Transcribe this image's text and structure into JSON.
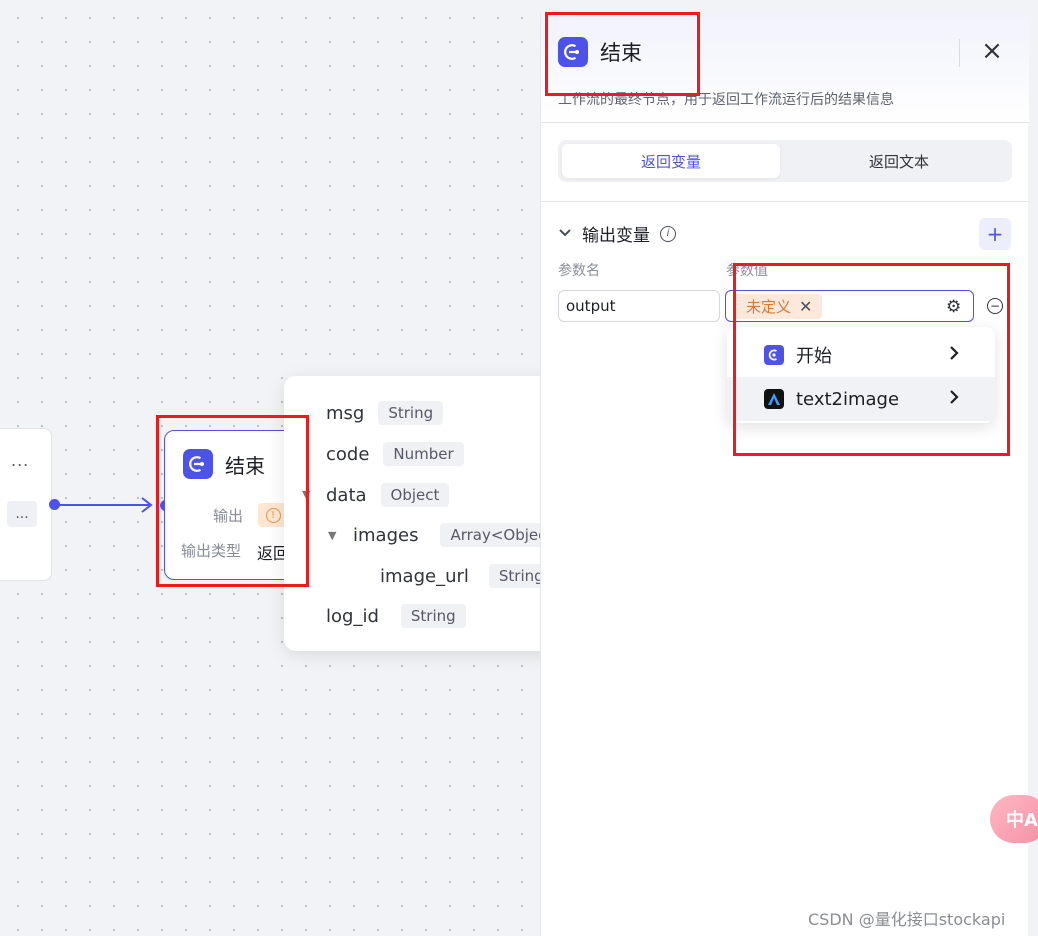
{
  "canvas": {
    "prev_node": {
      "more_1": "...",
      "more_2": "..."
    },
    "end_node": {
      "title": "结束",
      "output_label": "输出",
      "output_type_label": "输出类型",
      "output_type_value": "返回"
    }
  },
  "popover": {
    "items": [
      {
        "name": "msg",
        "type": "String"
      },
      {
        "name": "code",
        "type": "Number"
      },
      {
        "name": "data",
        "type": "Object"
      },
      {
        "name": "images",
        "type": "Array<Object>"
      },
      {
        "name": "image_url",
        "type": "String"
      },
      {
        "name": "log_id",
        "type": "String"
      }
    ]
  },
  "panel": {
    "title": "结束",
    "close": "×",
    "description": "工作流的最终节点，用于返回工作流运行后的结果信息",
    "tabs": {
      "return_variable": "返回变量",
      "return_text": "返回文本"
    },
    "output_section": {
      "title": "输出变量",
      "add": "+",
      "param_name_label": "参数名",
      "param_value_label": "参数值",
      "row": {
        "name": "output",
        "value_tag": "未定义"
      }
    },
    "dropdown": [
      {
        "label": "开始"
      },
      {
        "label": "text2image"
      }
    ]
  },
  "translate_badge": "中A",
  "watermark": "CSDN @量化接口stockapi",
  "colors": {
    "accent": "#4d53e8",
    "warning": "#e0772c",
    "annotation": "#ec1c1c"
  }
}
